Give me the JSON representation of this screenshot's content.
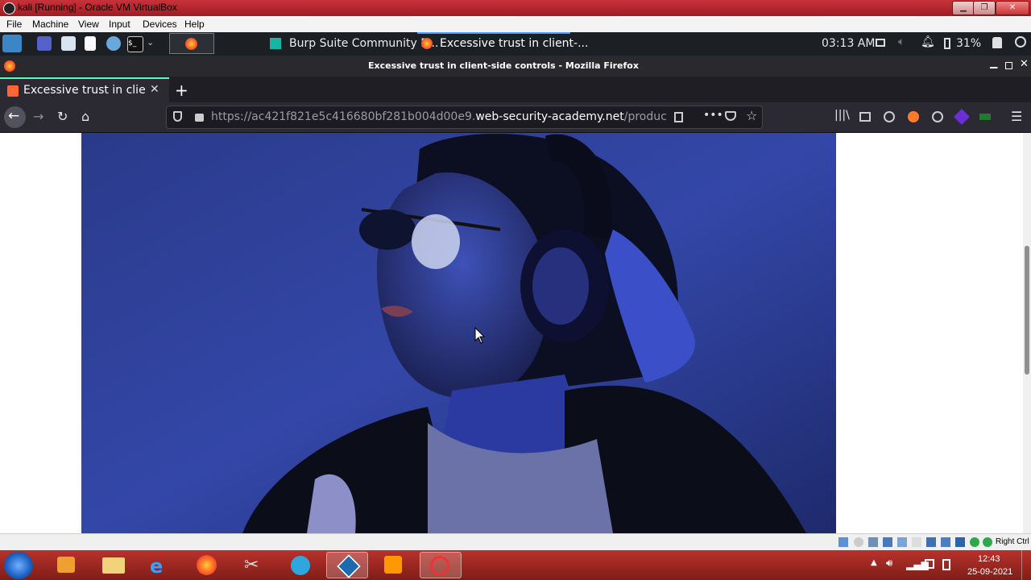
{
  "vbox": {
    "title": "kali [Running] - Oracle VM VirtualBox",
    "menu": [
      "File",
      "Machine",
      "View",
      "Input",
      "Devices",
      "Help"
    ],
    "host_key": "Right Ctrl"
  },
  "kali_panel": {
    "tasks": [
      {
        "label": "Burp Suite Community E..."
      },
      {
        "label": "Excessive trust in client-..."
      }
    ],
    "clock": "03:13 AM",
    "battery": "31%"
  },
  "firefox": {
    "window_title": "Excessive trust in client-side controls - Mozilla Firefox",
    "tab_title": "Excessive trust in client-s",
    "url_prefix": "https://ac421f821e5c416680bf281b004d00e9.",
    "url_domain": "web-security-academy.net",
    "url_path": "/product?pro"
  },
  "windows_taskbar": {
    "time": "12:43",
    "date": "25-09-2021"
  },
  "colors": {
    "vbox_red": "#b02a30",
    "kali_panel": "#1c1f24",
    "firefox_dark": "#2b2a33",
    "accent_tab": "#54ffbd",
    "photo_blue": "#2d3f9a"
  }
}
